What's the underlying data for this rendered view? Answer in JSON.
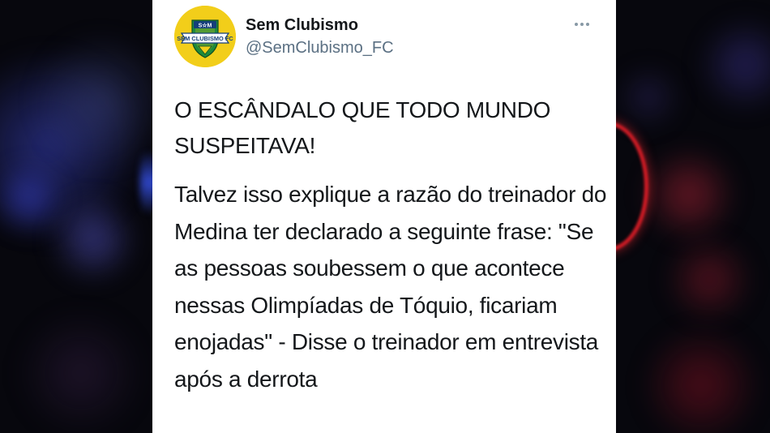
{
  "tweet": {
    "display_name": "Sem Clubismo",
    "handle": "@SemClubismo_FC",
    "headline": "O ESCÂNDALO QUE TODO MUNDO SUSPEITAVA!",
    "body": "Talvez isso explique a razão do treinador do Medina ter declarado a seguinte frase: \"Se as pessoas soubessem o que acontece nessas Olimpíadas de Tóquio, ficariam enojadas\" - Disse o treinador em entrevista após a derrota",
    "more_icon": "more-options-icon",
    "avatar": {
      "badge_text": "SEM CLUBISMO FC",
      "badge_top_text": "SEM",
      "colors": {
        "circle": "#f2ce1a",
        "shield": "#1f8a3c",
        "banner": "#153f7a"
      }
    }
  },
  "colors": {
    "card_bg": "#ffffff",
    "text": "#14171a",
    "secondary_text": "#5b7083"
  }
}
